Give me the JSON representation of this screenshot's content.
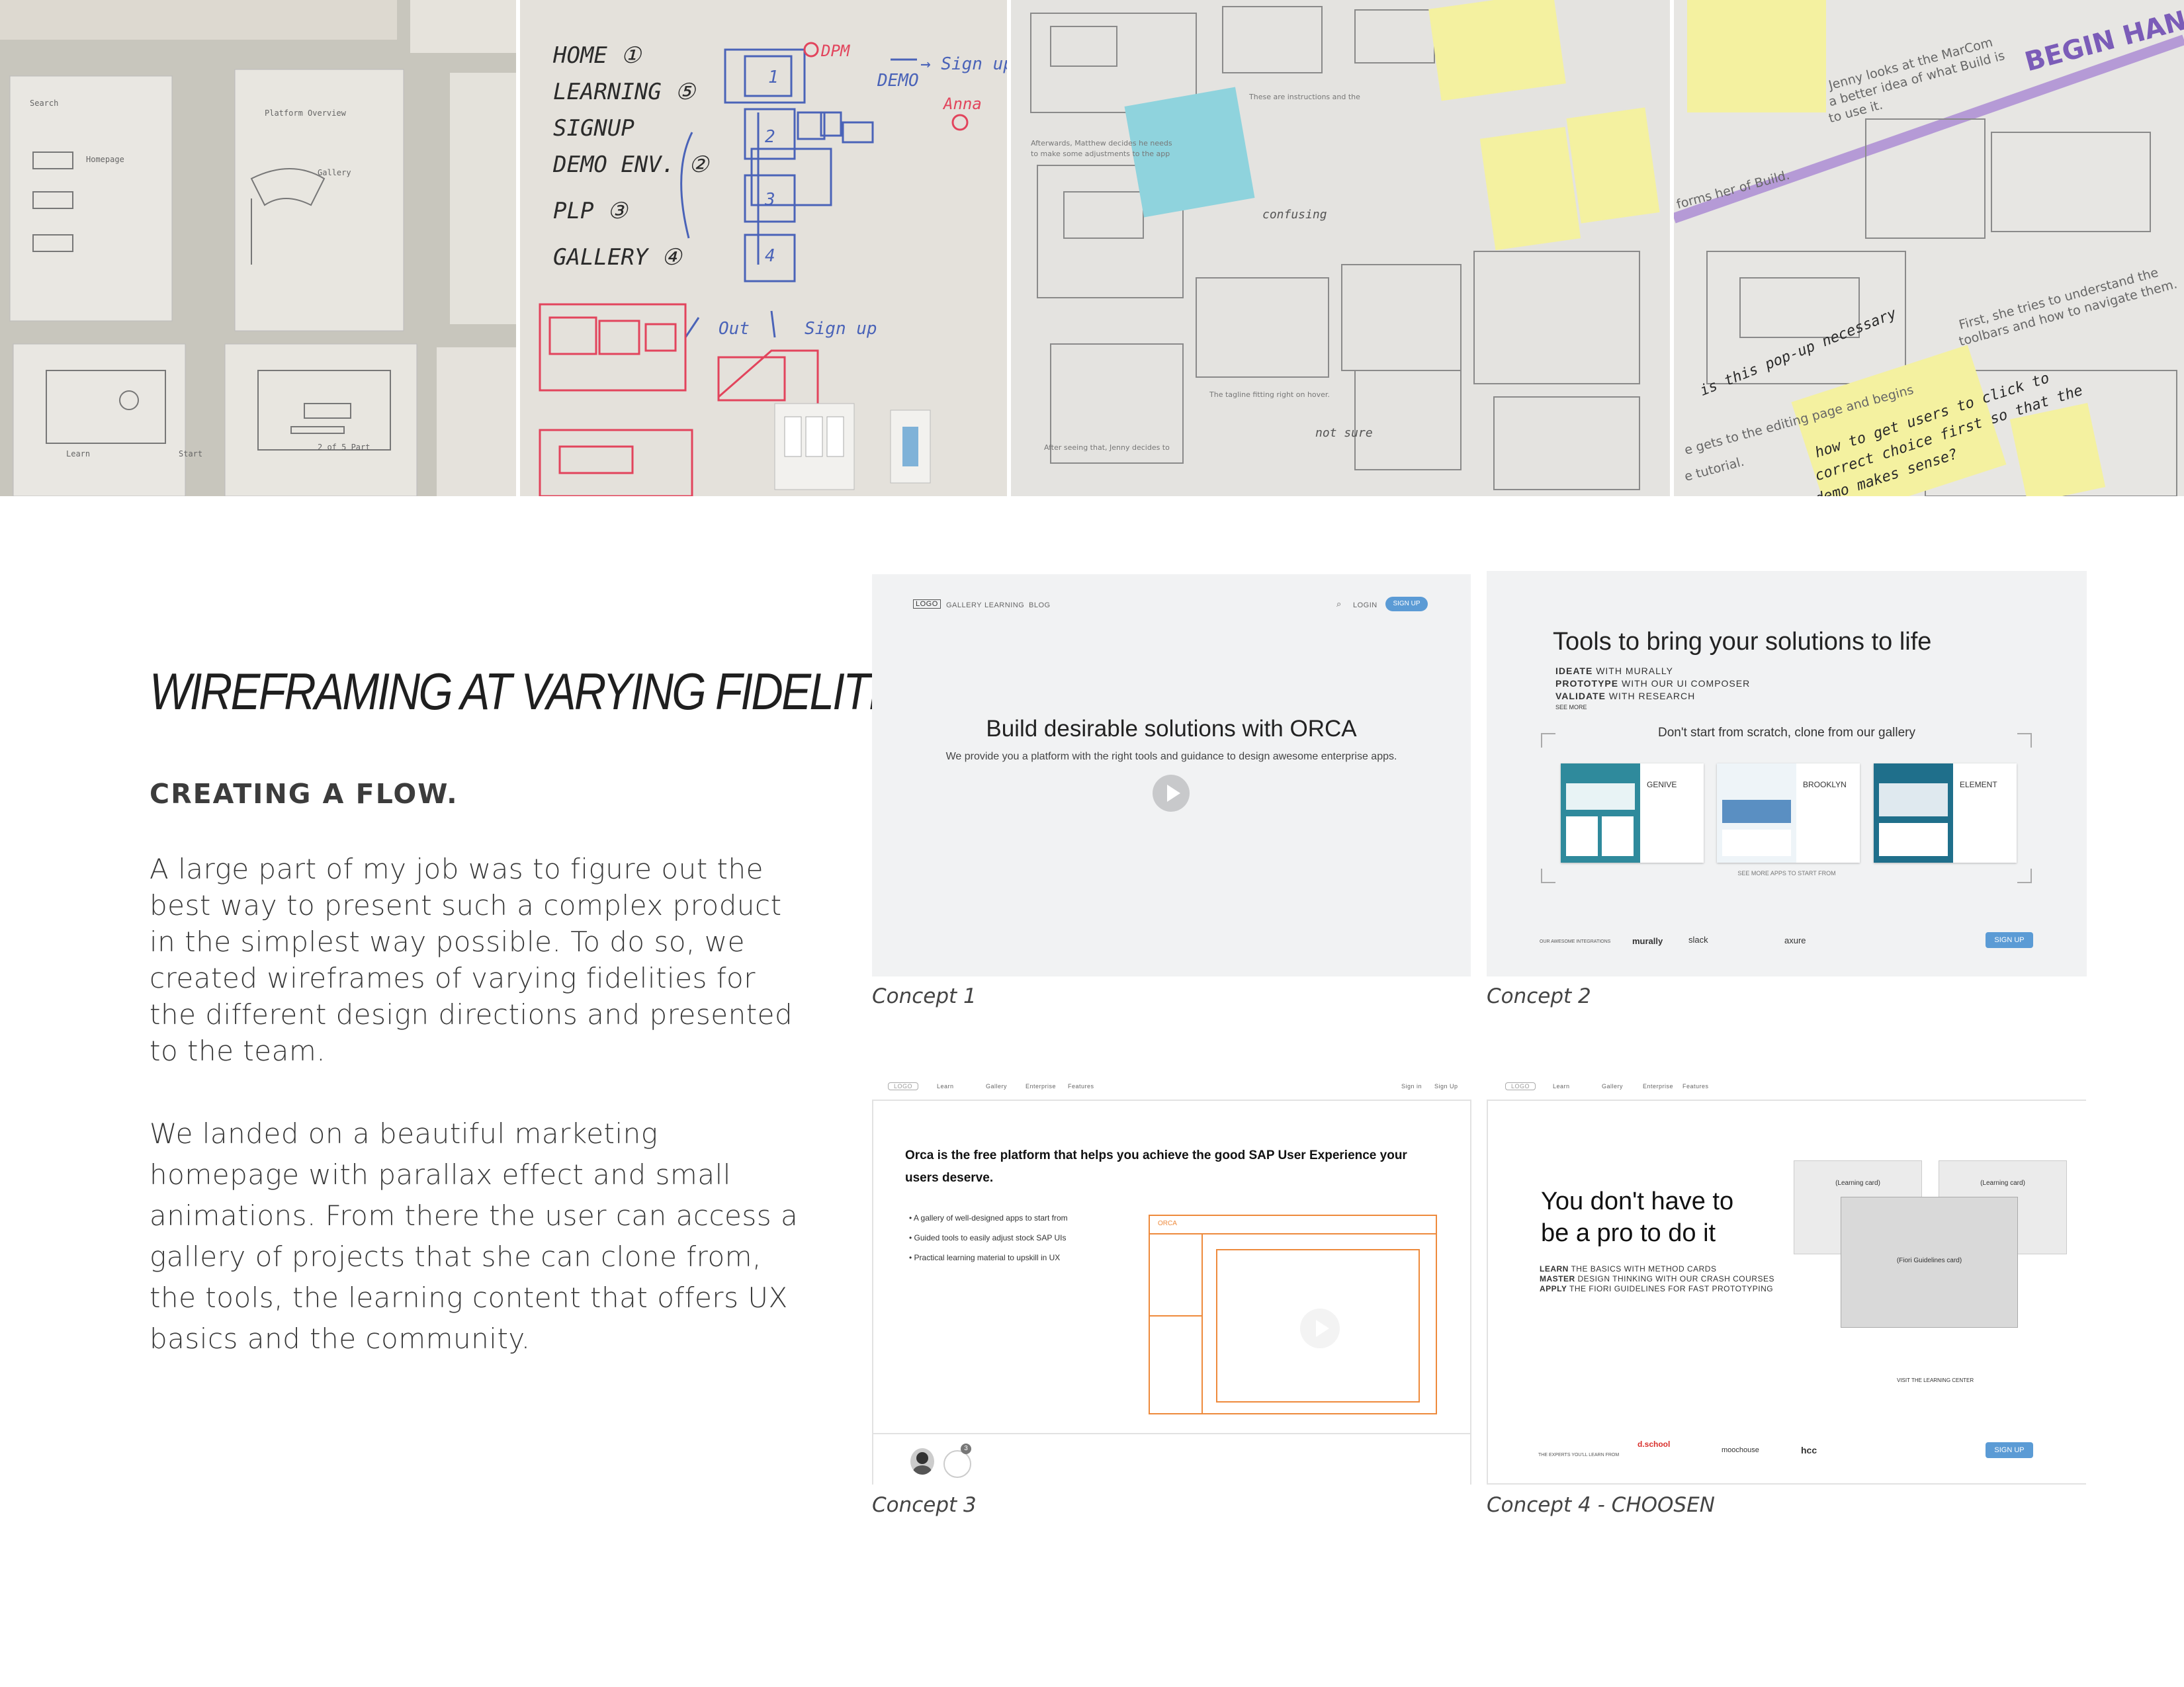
{
  "photos": {
    "whiteboard": {
      "list_items": [
        "HOME ①",
        "LEARNING ⑤",
        "SIGNUP",
        "DEMO ENV. ②",
        "PLP ③",
        "GALLERY ④"
      ],
      "notes": [
        "DPM",
        "DEMO",
        "→ Sign up",
        "Anna",
        "Out",
        "Sign up"
      ],
      "boxes": [
        "1",
        "2",
        "3",
        "4"
      ]
    },
    "sticky_right": [
      "BEGIN HAND",
      "Jenny looks at the MarCom",
      "a better idea of what Build is",
      "to use it.",
      "First, she tries to understand the",
      "toolbars and how to navigate them.",
      "is this pop-up necessary",
      "how to get users to click to",
      "correct choice first so that the",
      "demo makes sense?",
      "forms her of Build.",
      "e gets to the editing page and begins",
      "e tutorial."
    ]
  },
  "left": {
    "title": "WIREFRAMING AT VARYING FIDELITIES",
    "subtitle": "CREATING A FLOW.",
    "paragraph1": "A large part of my job was to figure out the best way to present such a complex product in the simplest way possible.  To do so, we created wireframes of varying fidelities for the different design directions and presented to the team.",
    "paragraph2": "We landed on a beautiful marketing homepage with parallax effect and small animations. From there the user can access a gallery of projects that she can clone from, the tools, the learning content that offers UX basics and the community."
  },
  "concept1": {
    "caption": "Concept 1",
    "logo": "LOGO",
    "nav": [
      "GALLERY",
      "LEARNING",
      "BLOG"
    ],
    "login": "LOGIN",
    "signup": "SIGN UP",
    "headline": "Build desirable solutions with ORCA",
    "subhead": "We provide you a platform with the right tools and guidance to design awesome enterprise apps."
  },
  "concept2": {
    "caption": "Concept 2",
    "headline": "Tools to bring your solutions to life",
    "lines": [
      {
        "bold": "IDEATE",
        "rest": " WITH MURALLY"
      },
      {
        "bold": "PROTOTYPE",
        "rest": " WITH OUR UI COMPOSER"
      },
      {
        "bold": "VALIDATE",
        "rest": " WITH RESEARCH"
      }
    ],
    "see_more": "SEE MORE",
    "clone_text": "Don't start from scratch, clone from our gallery",
    "apps": [
      "GENIVE",
      "BROOKLYN",
      "ELEMENT"
    ],
    "see_more_apps": "SEE MORE APPS TO START FROM",
    "integrations_label": "OUR AWESOME INTEGRATIONS",
    "integrations": [
      "murally",
      "slack",
      "axure"
    ],
    "signup": "SIGN UP"
  },
  "concept3": {
    "caption": "Concept 3",
    "nav_logo": "LOGO",
    "nav": [
      "Learn",
      "Gallery",
      "Enterprise",
      "Features"
    ],
    "signin": "Sign in",
    "signup": "Sign Up",
    "headline": "Orca is the free platform that helps you achieve the good SAP User Experience your users deserve.",
    "bullets": [
      "A gallery of well-designed apps to start from",
      "Guided tools to easily adjust stock SAP UIs",
      "Practical learning material to upskill in UX"
    ],
    "window_label": "ORCA",
    "badge": "3"
  },
  "concept4": {
    "caption": "Concept 4 - CHOOSEN",
    "nav_logo": "LOGO",
    "nav": [
      "Learn",
      "Gallery",
      "Enterprise",
      "Features"
    ],
    "headline_line1": "You don't have to",
    "headline_line2": "be a pro to do it",
    "lines": [
      {
        "bold": "LEARN",
        "rest": " THE BASICS WITH METHOD CARDS"
      },
      {
        "bold": "MASTER",
        "rest": " DESIGN THINKING WITH OUR CRASH COURSES"
      },
      {
        "bold": "APPLY",
        "rest": " THE FIORI GUIDELINES FOR FAST PROTOTYPING"
      }
    ],
    "card1": "(Learning card)",
    "card2": "(Learning card)",
    "card3": "(Fiori Guidelines card)",
    "visit": "VISIT THE LEARNING CENTER",
    "experts_label": "THE EXPERTS YOU'LL LEARN FROM",
    "partners": [
      "d.school",
      "moochouse",
      "hcc"
    ],
    "signup": "SIGN UP"
  },
  "colors": {
    "blue_button": "#5b9bd5",
    "orange_wire": "#ee8a3c",
    "sticky_yellow": "#f4f1a0",
    "sticky_blue": "#8fd3dd"
  }
}
